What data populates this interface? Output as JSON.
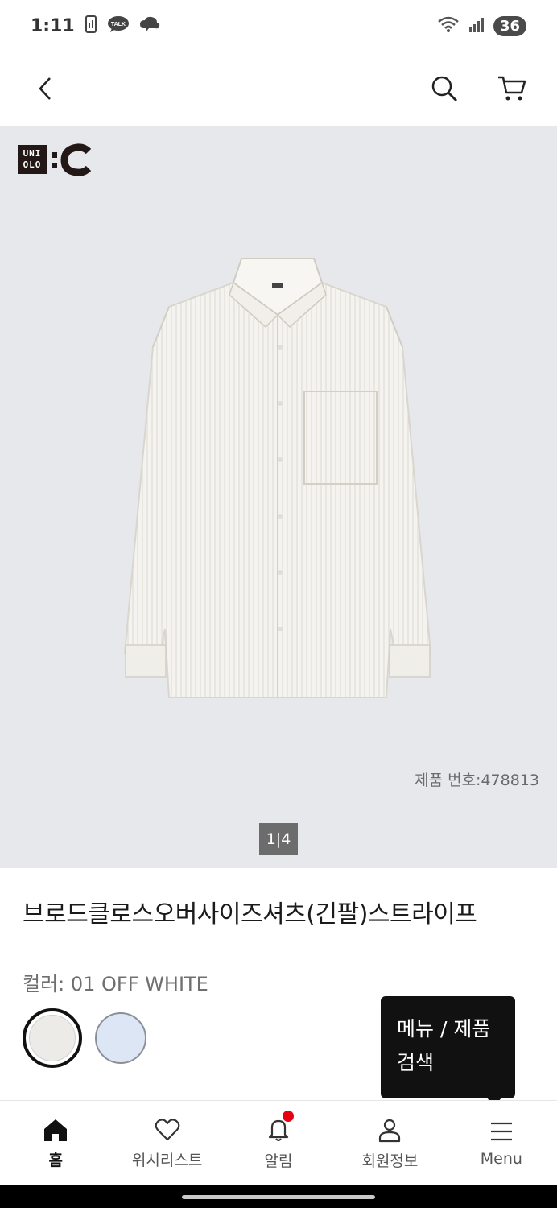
{
  "status_bar": {
    "time": "1:11",
    "battery": "36",
    "icons": [
      "sim-icon",
      "talk-icon",
      "cloud-icon",
      "wifi-icon",
      "signal-icon"
    ]
  },
  "header": {
    "back_icon": "chevron-left-icon",
    "search_icon": "search-icon",
    "cart_icon": "cart-icon"
  },
  "hero": {
    "brand_top": "UNI",
    "brand_bottom": "QLO",
    "brand_suffix": ":C",
    "product_number": "제품 번호:478813",
    "pager": "1|4"
  },
  "product": {
    "title": "브로드클로스오버사이즈셔츠(긴팔)스트라이프",
    "color_label": "컬러: 01 OFF WHITE",
    "swatches": [
      {
        "name": "off-white",
        "color": "#ecebe7",
        "selected": true
      },
      {
        "name": "blue",
        "color": "#dce6f5",
        "selected": false
      }
    ]
  },
  "tooltip": {
    "text_line1": "메뉴 / 제품",
    "text_line2": "검색"
  },
  "bottom_nav": {
    "items": [
      {
        "label": "홈",
        "icon": "home-icon"
      },
      {
        "label": "위시리스트",
        "icon": "heart-icon"
      },
      {
        "label": "알림",
        "icon": "bell-icon"
      },
      {
        "label": "회원정보",
        "icon": "user-icon"
      },
      {
        "label": "Menu",
        "icon": "menu-icon"
      }
    ]
  },
  "colors": {
    "accent_red": "#e60012",
    "hero_bg": "#e7e8ec",
    "tooltip_bg": "#111111"
  }
}
